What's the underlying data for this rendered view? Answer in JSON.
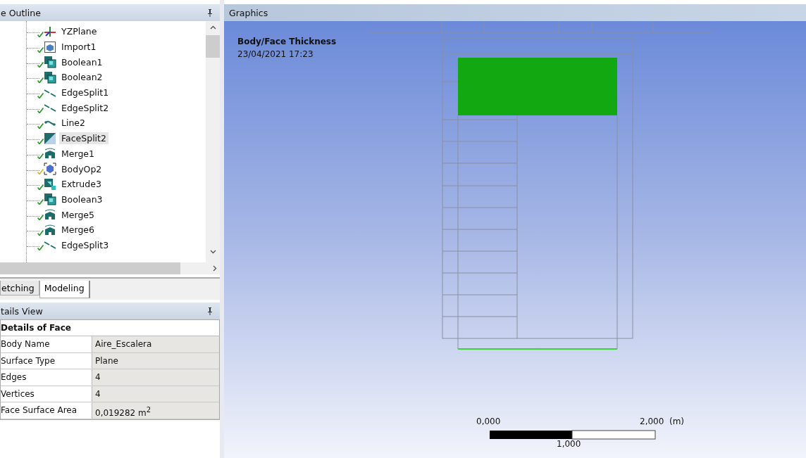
{
  "outline": {
    "title": "e Outline",
    "items": [
      {
        "label": "YZPlane",
        "kind": "plane",
        "warning": false,
        "selected": false
      },
      {
        "label": "Import1",
        "kind": "import",
        "warning": false,
        "selected": false
      },
      {
        "label": "Boolean1",
        "kind": "boolean",
        "warning": false,
        "selected": false
      },
      {
        "label": "Boolean2",
        "kind": "boolean",
        "warning": false,
        "selected": false
      },
      {
        "label": "EdgeSplit1",
        "kind": "edgesplit",
        "warning": false,
        "selected": false
      },
      {
        "label": "EdgeSplit2",
        "kind": "edgesplit",
        "warning": false,
        "selected": false
      },
      {
        "label": "Line2",
        "kind": "line",
        "warning": false,
        "selected": false
      },
      {
        "label": "FaceSplit2",
        "kind": "facesplit",
        "warning": false,
        "selected": true
      },
      {
        "label": "Merge1",
        "kind": "merge",
        "warning": false,
        "selected": false
      },
      {
        "label": "BodyOp2",
        "kind": "bodyop",
        "warning": true,
        "selected": false
      },
      {
        "label": "Extrude3",
        "kind": "extrude",
        "warning": false,
        "selected": false
      },
      {
        "label": "Boolean3",
        "kind": "boolean",
        "warning": false,
        "selected": false
      },
      {
        "label": "Merge5",
        "kind": "merge",
        "warning": false,
        "selected": false
      },
      {
        "label": "Merge6",
        "kind": "merge",
        "warning": false,
        "selected": false
      },
      {
        "label": "EdgeSplit3",
        "kind": "edgesplit",
        "warning": false,
        "selected": false
      }
    ]
  },
  "tabs": [
    {
      "label": "etching",
      "selected": false
    },
    {
      "label": "Modeling",
      "selected": true
    }
  ],
  "details": {
    "title": "tails View",
    "heading": "Details of Face",
    "rows": [
      {
        "name": "Body Name",
        "value": "Aire_Escalera"
      },
      {
        "name": "Surface Type",
        "value": "Plane"
      },
      {
        "name": "Edges",
        "value": "4"
      },
      {
        "name": "Vertices",
        "value": "4"
      },
      {
        "name": "Face Surface Area",
        "value": "0,019282 m$^{2}$"
      }
    ]
  },
  "graphics": {
    "title": "Graphics",
    "result_title": "Body/Face Thickness",
    "timestamp": "23/04/2021 17:23",
    "scale": {
      "start": "0,000",
      "middle": "1,000",
      "end": "2,000",
      "unit": "(m)"
    }
  }
}
